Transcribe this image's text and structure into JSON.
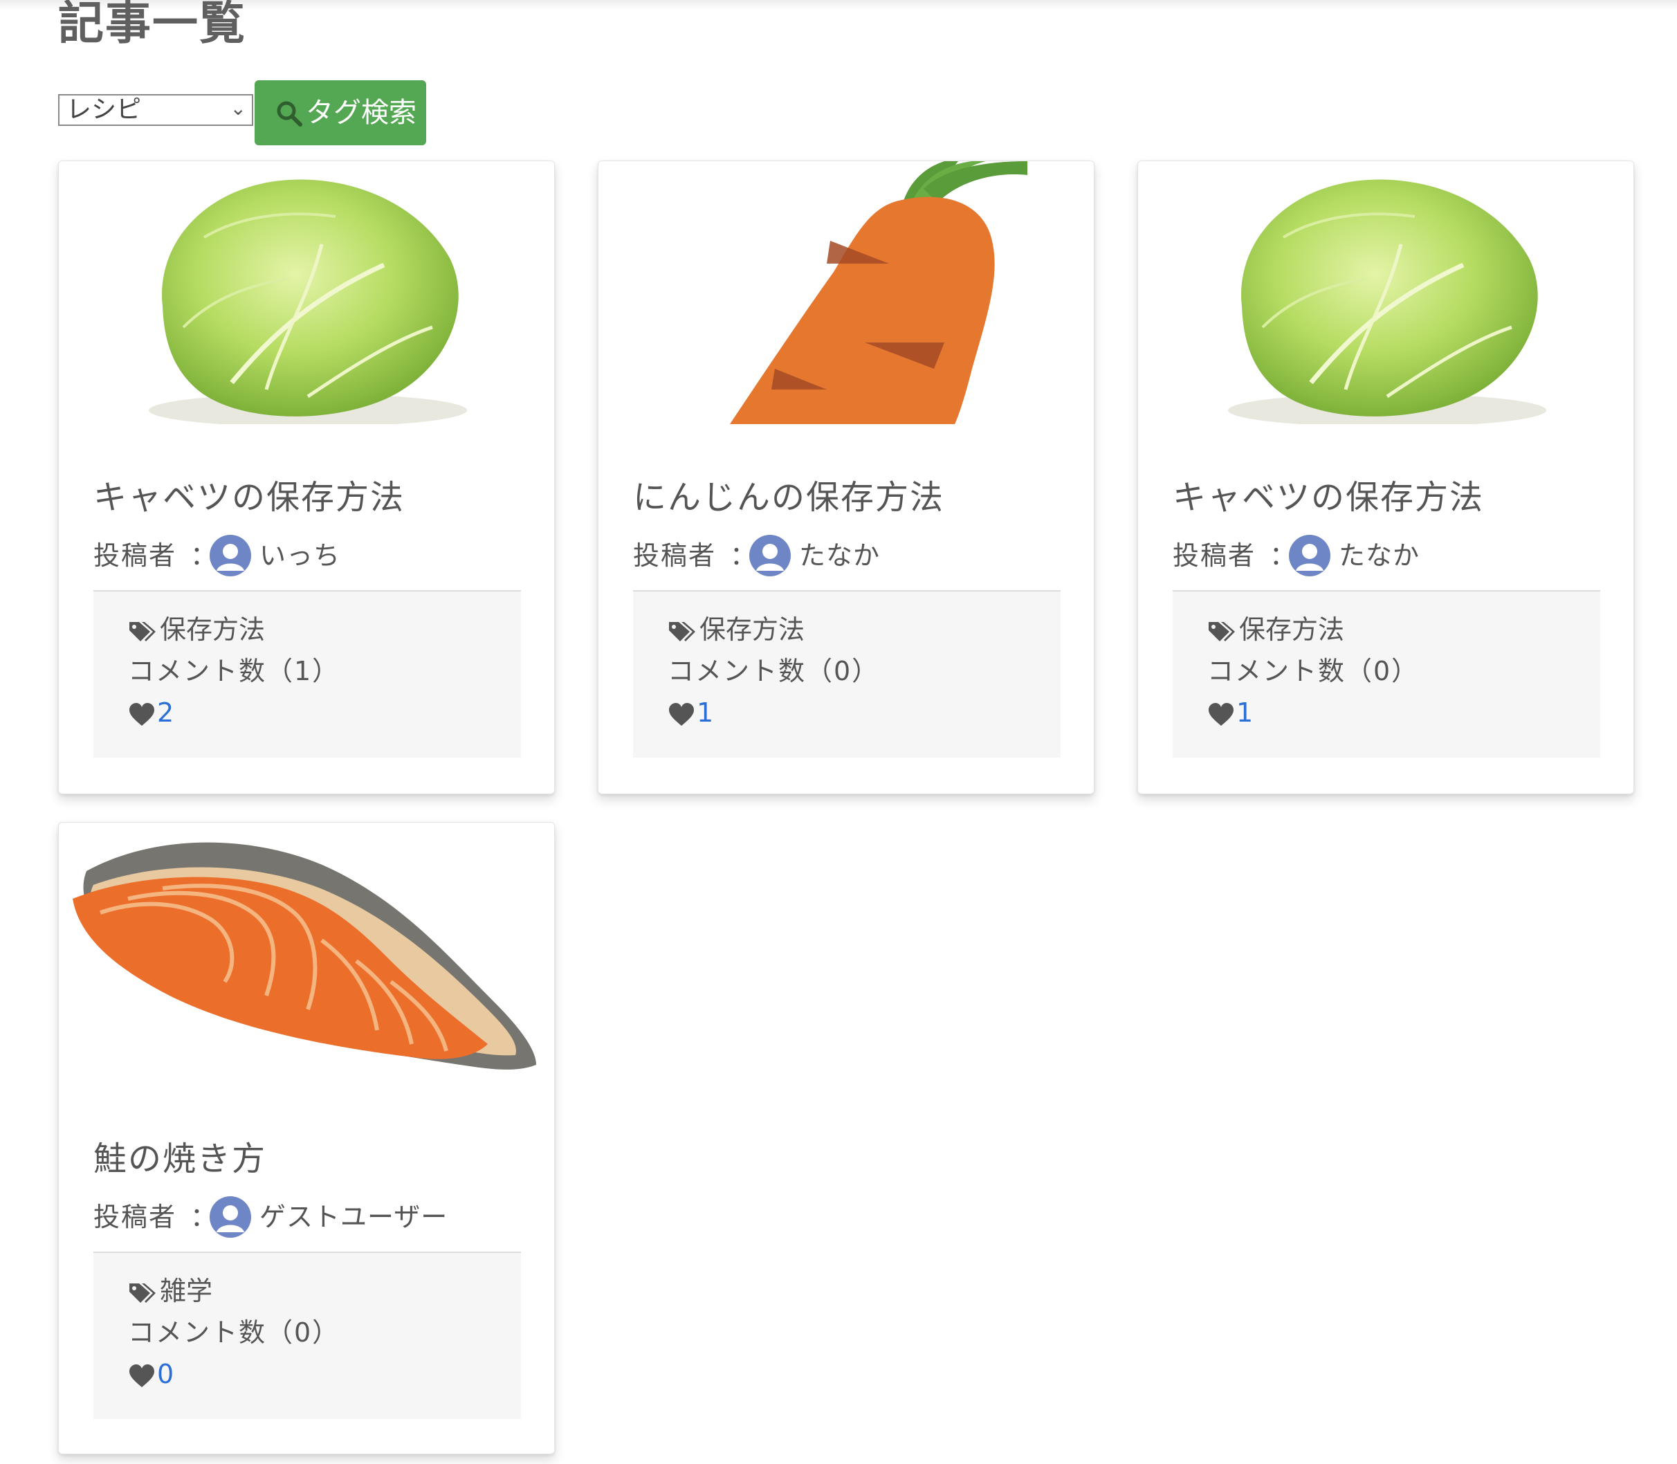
{
  "page": {
    "title": "記事一覧"
  },
  "search": {
    "selected_tag": "レシピ",
    "button_label": "タグ検索"
  },
  "labels": {
    "author_label": "投稿者",
    "colon": "："
  },
  "colors": {
    "accent_green": "#55a853",
    "link_blue": "#2a6fd6",
    "text_gray": "#5f5f5f"
  },
  "articles": [
    {
      "title": "キャベツの保存方法",
      "author": "いっち",
      "tag": "保存方法",
      "comments": "コメント数（1）",
      "likes": "2",
      "image": "cabbage"
    },
    {
      "title": "にんじんの保存方法",
      "author": "たなか",
      "tag": "保存方法",
      "comments": "コメント数（0）",
      "likes": "1",
      "image": "carrot"
    },
    {
      "title": "キャベツの保存方法",
      "author": "たなか",
      "tag": "保存方法",
      "comments": "コメント数（0）",
      "likes": "1",
      "image": "cabbage"
    },
    {
      "title": "鮭の焼き方",
      "author": "ゲストユーザー",
      "tag": "雑学",
      "comments": "コメント数（0）",
      "likes": "0",
      "image": "salmon"
    }
  ]
}
